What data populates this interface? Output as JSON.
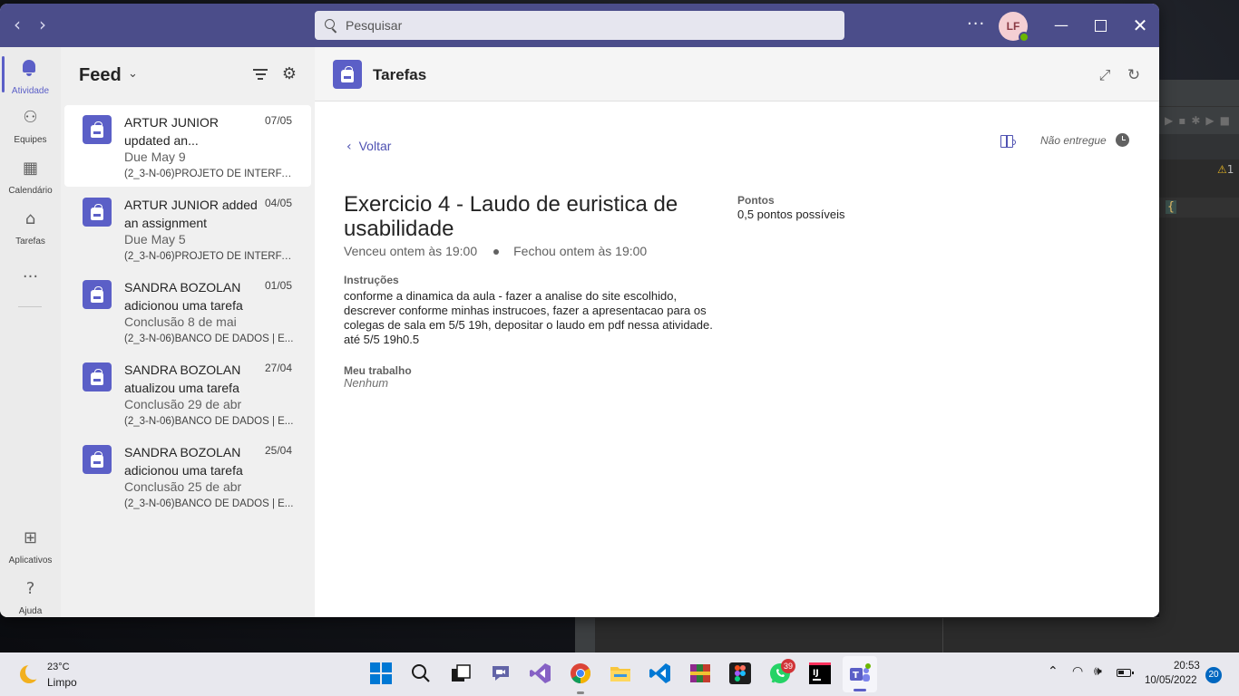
{
  "titlebar": {
    "search_placeholder": "Pesquisar",
    "avatar_initials": "LF",
    "more_label": "···"
  },
  "rail": {
    "items": [
      {
        "label": "Atividade",
        "icon": "bell-icon",
        "active": true
      },
      {
        "label": "Equipes",
        "icon": "teams-icon"
      },
      {
        "label": "Calendário",
        "icon": "calendar-icon"
      },
      {
        "label": "Tarefas",
        "icon": "assignments-icon"
      },
      {
        "label": "···",
        "icon": "more-icon"
      }
    ],
    "bottom": [
      {
        "label": "Aplicativos",
        "icon": "apps-icon"
      },
      {
        "label": "Ajuda",
        "icon": "help-icon"
      }
    ]
  },
  "feed": {
    "title": "Feed",
    "items": [
      {
        "who": "ARTUR JUNIOR updated an...",
        "date": "07/05",
        "due": "Due May 9",
        "class": "(2_3-N-06)PROJETO DE INTERFA..."
      },
      {
        "who": "ARTUR JUNIOR added an assignment",
        "date": "04/05",
        "due": "Due May 5",
        "class": "(2_3-N-06)PROJETO DE INTERFA..."
      },
      {
        "who": "SANDRA BOZOLAN adicionou uma tarefa",
        "date": "01/05",
        "due": "Conclusão 8 de mai",
        "class": "(2_3-N-06)BANCO DE DADOS | E..."
      },
      {
        "who": "SANDRA BOZOLAN atualizou uma tarefa",
        "date": "27/04",
        "due": "Conclusão 29 de abr",
        "class": "(2_3-N-06)BANCO DE DADOS | E..."
      },
      {
        "who": "SANDRA BOZOLAN adicionou uma tarefa",
        "date": "25/04",
        "due": "Conclusão 25 de abr",
        "class": "(2_3-N-06)BANCO DE DADOS | E..."
      }
    ]
  },
  "main": {
    "app_title": "Tarefas",
    "back_label": "Voltar",
    "status": "Não entregue",
    "assignment": {
      "title": "Exercicio 4 - Laudo de euristica de usabilidade",
      "due": "Venceu ontem às 19:00",
      "closed": "Fechou ontem às 19:00",
      "instructions_label": "Instruções",
      "instructions": "conforme a dinamica da aula - fazer a analise do site escolhido, descrever conforme minhas instrucoes, fazer a apresentacao para os colegas de sala em 5/5 19h, depositar o laudo em pdf nessa atividade. até 5/5 19h0.5",
      "my_work_label": "Meu trabalho",
      "my_work_value": "Nenhum",
      "points_label": "Pontos",
      "points_value": "0,5 pontos possíveis"
    }
  },
  "background_ide": {
    "warning_count": "1",
    "brace": "{"
  },
  "taskbar": {
    "weather_temp": "23°C",
    "weather_desc": "Limpo",
    "whatsapp_badge": "39",
    "time": "20:53",
    "date": "10/05/2022",
    "notifications": "20",
    "apps": [
      "windows-start-icon",
      "search-icon",
      "task-view-icon",
      "chat-icon",
      "visual-studio-icon",
      "chrome-icon",
      "file-explorer-icon",
      "vscode-icon",
      "winrar-icon",
      "figma-icon",
      "whatsapp-icon",
      "intellij-icon",
      "teams-icon"
    ]
  },
  "colors": {
    "teams_purple": "#5b5fc7",
    "titlebar": "#4b4d8a",
    "link": "#4f52b2"
  }
}
